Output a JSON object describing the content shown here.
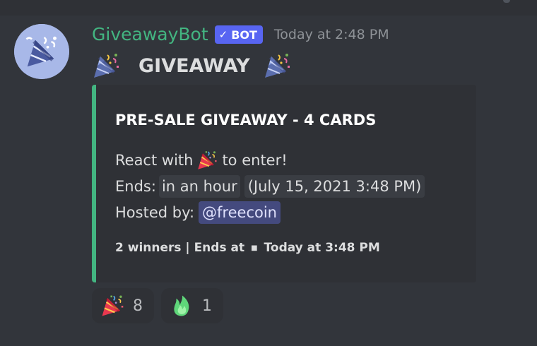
{
  "message": {
    "author": "GiveawayBot",
    "bot_tag": "BOT",
    "bot_check": "✓",
    "timestamp": "Today at 2:48 PM",
    "content_title": "GIVEAWAY",
    "content_emoji": "party-popper-icon"
  },
  "embed": {
    "accent_color": "#43b581",
    "title": "PRE-SALE GIVEAWAY - 4 CARDS",
    "react_prefix": "React with",
    "react_suffix": "to enter!",
    "ends_label": "Ends:",
    "ends_relative": "in an hour",
    "ends_absolute": "(July 15, 2021 3:48 PM)",
    "hosted_label": "Hosted by:",
    "host_mention": "@freecoin",
    "footer_winners": "2 winners | Ends at",
    "footer_separator": "■",
    "footer_time": "Today at 3:48 PM"
  },
  "reactions": [
    {
      "emoji": "party-popper-icon",
      "count": "8"
    },
    {
      "emoji": "green-flame-icon",
      "count": "1"
    }
  ],
  "colors": {
    "background": "#36393f",
    "username": "#43b581",
    "bot_tag": "#5865f2",
    "mention_bg": "#444a7e"
  }
}
